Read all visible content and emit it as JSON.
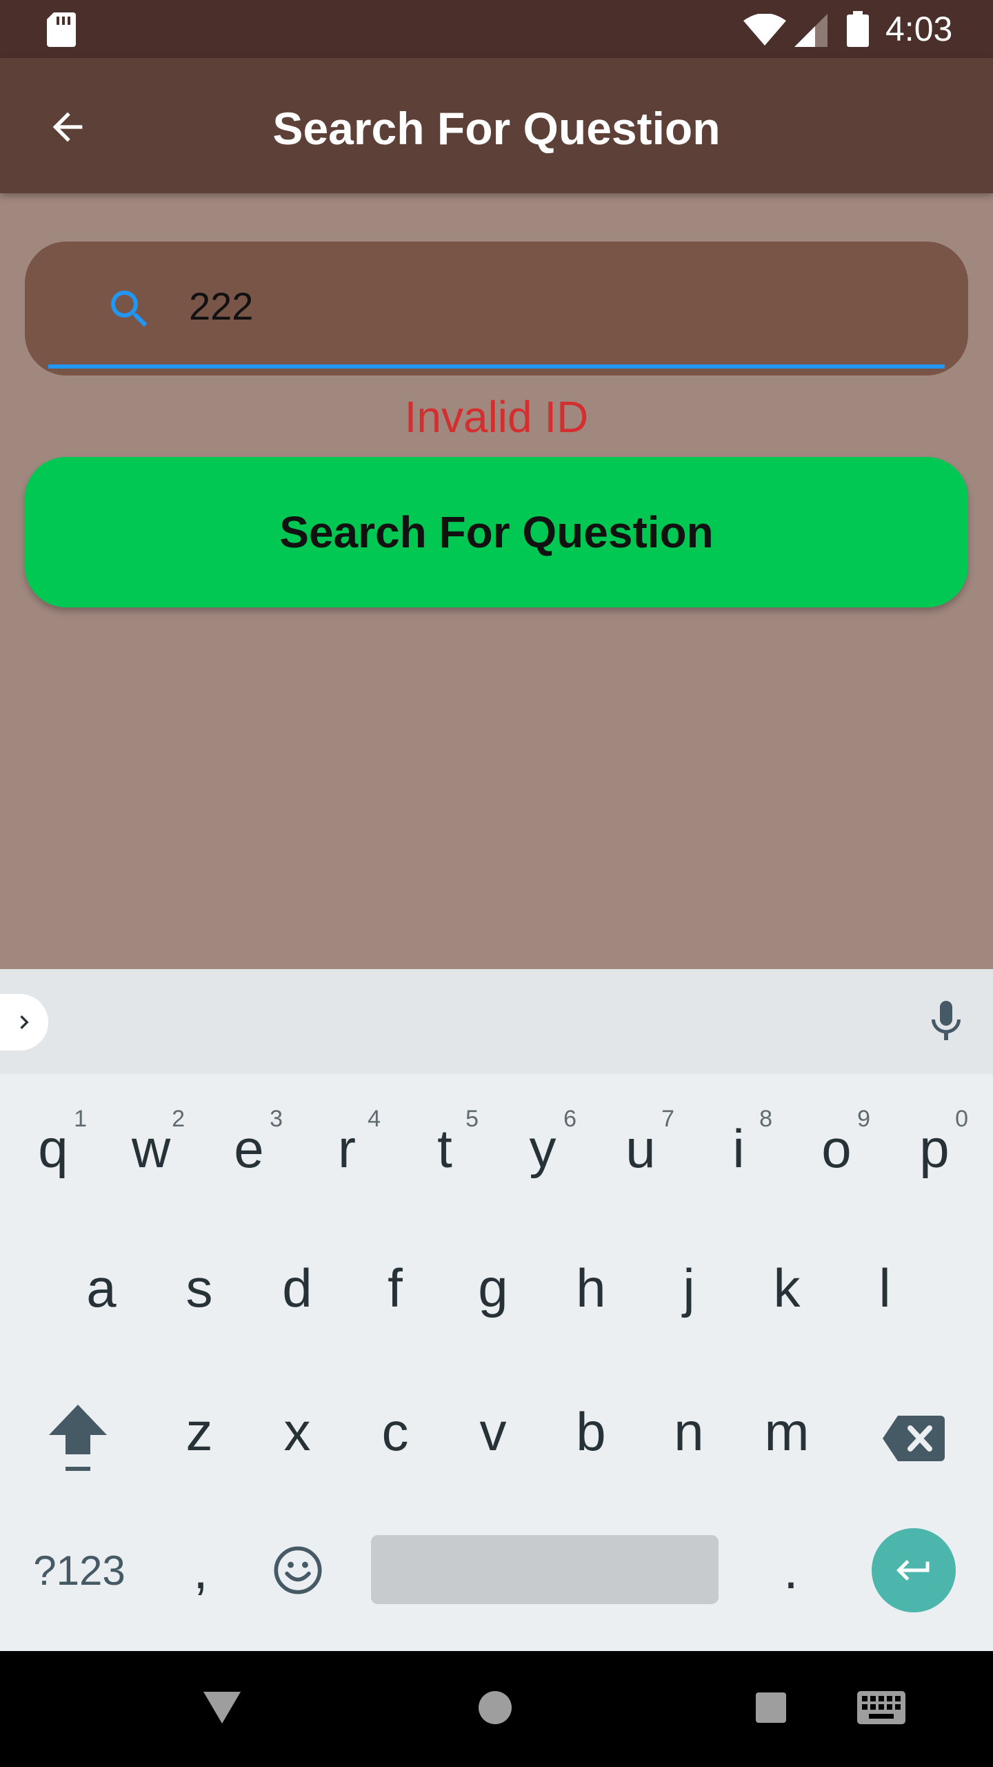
{
  "status_bar": {
    "time": "4:03",
    "icons": [
      "sd-card-icon",
      "wifi-icon",
      "cell-signal-icon",
      "battery-icon"
    ]
  },
  "app_bar": {
    "title": "Search For Question",
    "back_icon": "arrow-back-icon"
  },
  "search": {
    "icon": "search-icon",
    "value": "222"
  },
  "error_text": "Invalid ID",
  "search_button_label": "Search For Question",
  "keyboard": {
    "row1": [
      {
        "key": "q",
        "hint": "1"
      },
      {
        "key": "w",
        "hint": "2"
      },
      {
        "key": "e",
        "hint": "3"
      },
      {
        "key": "r",
        "hint": "4"
      },
      {
        "key": "t",
        "hint": "5"
      },
      {
        "key": "y",
        "hint": "6"
      },
      {
        "key": "u",
        "hint": "7"
      },
      {
        "key": "i",
        "hint": "8"
      },
      {
        "key": "o",
        "hint": "9"
      },
      {
        "key": "p",
        "hint": "0"
      }
    ],
    "row2": [
      "a",
      "s",
      "d",
      "f",
      "g",
      "h",
      "j",
      "k",
      "l"
    ],
    "row3": [
      "z",
      "x",
      "c",
      "v",
      "b",
      "n",
      "m"
    ],
    "symbols_label": "?123",
    "comma": ",",
    "period": "."
  },
  "colors": {
    "status_bar": "#4b2f2a",
    "app_bar": "#5d4037",
    "background": "#a1887f",
    "search_field": "#795548",
    "accent": "#2196f3",
    "error": "#d32f2f",
    "button": "#00c853",
    "enter": "#4db6ac"
  }
}
